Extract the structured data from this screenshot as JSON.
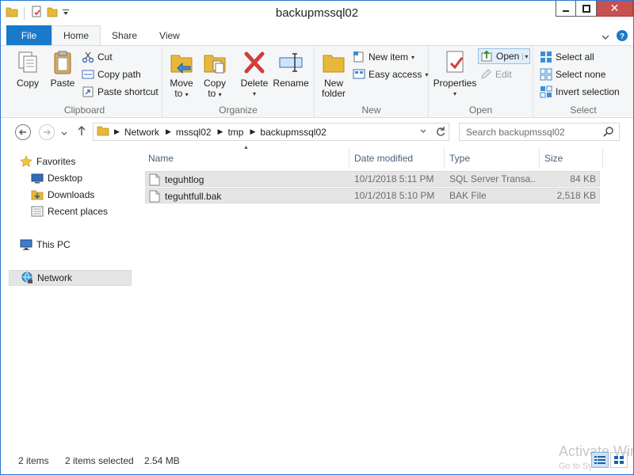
{
  "window": {
    "title": "backupmssql02"
  },
  "titlebar": {
    "minimize": "–",
    "close": "✕"
  },
  "ribbon_tabs": [
    {
      "label": "File"
    },
    {
      "label": "Home"
    },
    {
      "label": "Share"
    },
    {
      "label": "View"
    }
  ],
  "clipboard": {
    "group_label": "Clipboard",
    "copy": "Copy",
    "paste": "Paste",
    "cut": "Cut",
    "copy_path": "Copy path",
    "paste_shortcut": "Paste shortcut"
  },
  "organize": {
    "group_label": "Organize",
    "move_to_line1": "Move",
    "move_to_line2": "to",
    "copy_to_line1": "Copy",
    "copy_to_line2": "to",
    "delete": "Delete",
    "rename": "Rename"
  },
  "new": {
    "group_label": "New",
    "new_folder_line1": "New",
    "new_folder_line2": "folder",
    "new_item": "New item",
    "easy_access": "Easy access"
  },
  "open": {
    "group_label": "Open",
    "properties": "Properties",
    "open": "Open",
    "edit": "Edit"
  },
  "select": {
    "group_label": "Select",
    "select_all": "Select all",
    "select_none": "Select none",
    "invert_selection": "Invert selection"
  },
  "address": {
    "crumbs": [
      "Network",
      "mssql02",
      "tmp",
      "backupmssql02"
    ]
  },
  "search": {
    "placeholder": "Search backupmssql02"
  },
  "nav": {
    "favorites": "Favorites",
    "desktop": "Desktop",
    "downloads": "Downloads",
    "recent_places": "Recent places",
    "this_pc": "This PC",
    "network": "Network"
  },
  "columns": {
    "name": "Name",
    "date_modified": "Date modified",
    "type": "Type",
    "size": "Size"
  },
  "files": [
    {
      "name": "teguhtlog",
      "date": "10/1/2018 5:11 PM",
      "type": "SQL Server Transa...",
      "size": "84 KB"
    },
    {
      "name": "teguhtfull.bak",
      "date": "10/1/2018 5:10 PM",
      "type": "BAK File",
      "size": "2,518 KB"
    }
  ],
  "status": {
    "item_count": "2 items",
    "selection": "2 items selected",
    "selection_size": "2.54 MB"
  },
  "watermark": {
    "line1": "Activate Windows",
    "line2": "Go to System in Control Panel"
  },
  "colors": {
    "accent": "#1979ca",
    "selection": "#e5e5e5",
    "folder": "#e8b83a"
  }
}
